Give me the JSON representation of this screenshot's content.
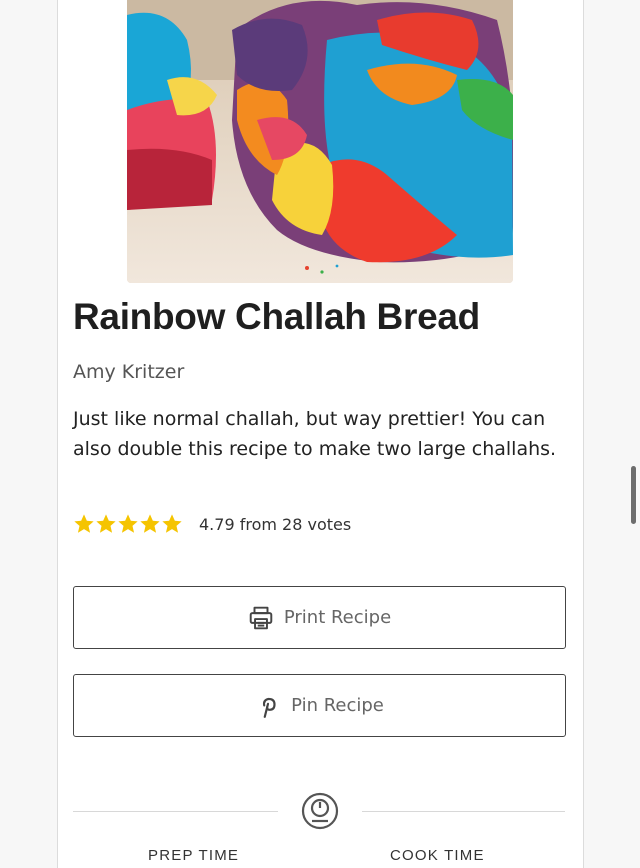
{
  "recipe": {
    "title": "Rainbow Challah Bread",
    "author": "Amy Kritzer",
    "summary": "Just like normal challah, but way prettier! You can also double this recipe to make two large challahs.",
    "rating": {
      "stars": 5,
      "star_color": "#f5c400",
      "text": "4.79 from 28 votes"
    }
  },
  "buttons": {
    "print_label": "Print Recipe",
    "pin_label": "Pin Recipe"
  },
  "times": {
    "prep_label": "PREP TIME",
    "cook_label": "COOK TIME"
  },
  "icons": {
    "print": "printer-icon",
    "pin": "pinterest-icon",
    "timer": "timer-icon",
    "star": "star-icon"
  }
}
